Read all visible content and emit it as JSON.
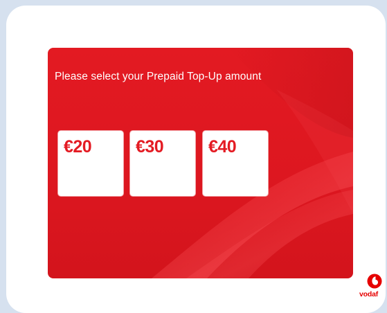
{
  "prompt": "Please select your Prepaid Top-Up amount",
  "topup_options": [
    {
      "label": "€20"
    },
    {
      "label": "€30"
    },
    {
      "label": "€40"
    }
  ],
  "brand": {
    "wordmark": "vodaf",
    "logo_icon": "vodafone-speechmark-icon",
    "color": "#e60000"
  },
  "colors": {
    "panel_red": "#e31a22",
    "amount_red": "#e41b23",
    "background": "#d6e1ef"
  }
}
